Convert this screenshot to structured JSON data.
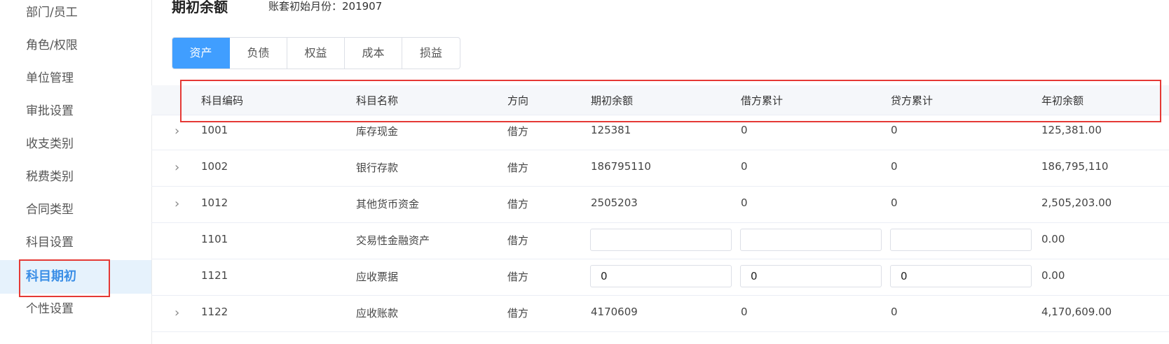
{
  "sidebar": {
    "items": [
      {
        "label": "部门/员工"
      },
      {
        "label": "角色/权限"
      },
      {
        "label": "单位管理"
      },
      {
        "label": "审批设置"
      },
      {
        "label": "收支类别"
      },
      {
        "label": "税费类别"
      },
      {
        "label": "合同类型"
      },
      {
        "label": "科目设置"
      },
      {
        "label": "科目期初"
      },
      {
        "label": "个性设置"
      }
    ],
    "active_index": 8
  },
  "header": {
    "title": "期初余额",
    "subtitle": "账套初始月份：201907"
  },
  "tabs": [
    {
      "label": "资产"
    },
    {
      "label": "负债"
    },
    {
      "label": "权益"
    },
    {
      "label": "成本"
    },
    {
      "label": "损益"
    }
  ],
  "table": {
    "columns": [
      "科目编码",
      "科目名称",
      "方向",
      "期初余额",
      "借方累计",
      "贷方累计",
      "年初余额"
    ],
    "rows": [
      {
        "expand": "›",
        "code": "1001",
        "name": "库存现金",
        "dir": "借方",
        "opening": "125381",
        "debit": "0",
        "credit": "0",
        "year": "125,381.00"
      },
      {
        "expand": "›",
        "code": "1002",
        "name": "银行存款",
        "dir": "借方",
        "opening": "186795110",
        "debit": "0",
        "credit": "0",
        "year": "186,795,110"
      },
      {
        "expand": "›",
        "code": "1012",
        "name": "其他货币资金",
        "dir": "借方",
        "opening": "2505203",
        "debit": "0",
        "credit": "0",
        "year": "2,505,203.00"
      },
      {
        "expand": "",
        "code": "1101",
        "name": "交易性金融资产",
        "dir": "借方",
        "opening_input": "",
        "debit_input": "",
        "credit_input": "",
        "year": "0.00"
      },
      {
        "expand": "",
        "code": "1121",
        "name": "应收票据",
        "dir": "借方",
        "opening_input": "0",
        "debit_input": "0",
        "credit_input": "0",
        "year": "0.00"
      },
      {
        "expand": "›",
        "code": "1122",
        "name": "应收账款",
        "dir": "借方",
        "opening": "4170609",
        "debit": "0",
        "credit": "0",
        "year": "4,170,609.00"
      }
    ]
  }
}
